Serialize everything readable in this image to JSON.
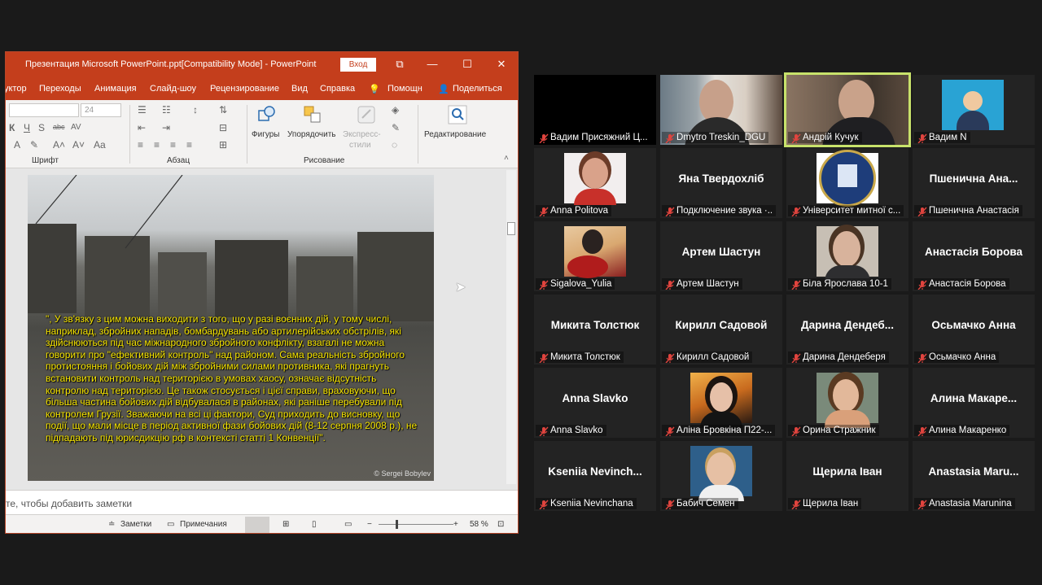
{
  "ppt": {
    "title": "Презентация Microsoft PowerPoint.ppt[Compatibility Mode]  -  PowerPoint",
    "signin_label": "Вход",
    "menu": [
      "уктор",
      "Переходы",
      "Анимация",
      "Слайд-шоу",
      "Рецензирование",
      "Вид",
      "Справка",
      "Помощн",
      "Поделиться"
    ],
    "ribbon": {
      "font_size": "24",
      "group_font": "Шрифт",
      "group_paragraph": "Абзац",
      "group_drawing": "Рисование",
      "shapes_label": "Фигуры",
      "arrange_label": "Упорядочить",
      "quick_styles_label_1": "Экспресс-",
      "quick_styles_label_2": "стили",
      "editing_label": "Редактирование"
    },
    "slide_text": "\", У зв'язку з цим можна виходити з того, що у разі воєнних дій, у тому числі, наприклад, збройних нападів, бомбардувань або артилерійських обстрілів, які здійснюються під час міжнародного збройного конфлікту, взагалі не можна говорити про \"ефективний контроль\" над районом. Сама реальність збройного протистояння і бойових дій між збройними силами противника, які прагнуть встановити контроль над територією в умовах хаосу, означає відсутність контролю над територією. Це також стосується і цієї справи, враховуючи, що більша частина бойових дій відбувалася в районах, які раніше перебували під контролем Грузії. Зважаючи на всі ці фактори, Суд приходить до висновку, що події, що мали місце в період активної фази бойових дій (8-12 серпня 2008 р.), не підпадають під юрисдикцію рф в контексті статті 1 Конвенції\".",
    "slide_credit": "© Sergei Bobylev",
    "notes_placeholder": "те, чтобы добавить заметки",
    "status": {
      "notes_label": "Заметки",
      "comments_label": "Примечания",
      "zoom": "58 %"
    }
  },
  "participants": [
    {
      "name": "Вадим Присяжний Ц...",
      "display": "",
      "kind": "black"
    },
    {
      "name": "Dmytro Treskin_DGU",
      "display": "",
      "kind": "video1"
    },
    {
      "name": "Андрій Кучук",
      "display": "",
      "kind": "video2",
      "active": true
    },
    {
      "name": "Вадим N",
      "display": "",
      "kind": "avatar-icon"
    },
    {
      "name": "Anna Politova",
      "display": "",
      "kind": "photo-woman"
    },
    {
      "name": "Подключение звука ·..",
      "display": "Яна Твердохліб",
      "kind": "text"
    },
    {
      "name": "Університет митної с...",
      "display": "",
      "kind": "logo"
    },
    {
      "name": "Пшенична Анастасія",
      "display": "Пшенична  Ана...",
      "kind": "text"
    },
    {
      "name": "Sigalova_Yulia",
      "display": "",
      "kind": "photo-roses"
    },
    {
      "name": "Артем Шастун",
      "display": "Артем Шастун",
      "kind": "text"
    },
    {
      "name": "Біла Ярослава 10-1",
      "display": "",
      "kind": "photo-girl1"
    },
    {
      "name": "Анастасія Борова",
      "display": "Анастасія Борова",
      "kind": "text"
    },
    {
      "name": "Микита Толстюк",
      "display": "Микита Толстюк",
      "kind": "text"
    },
    {
      "name": "Кирилл Садовой",
      "display": "Кирилл Садовой",
      "kind": "text"
    },
    {
      "name": "Дарина Дендеберя",
      "display": "Дарина  Дендеб...",
      "kind": "text"
    },
    {
      "name": "Осьмачко Анна",
      "display": "Осьмачко Анна",
      "kind": "text"
    },
    {
      "name": "Anna Slavko",
      "display": "Anna Slavko",
      "kind": "text"
    },
    {
      "name": "Аліна Бровкіна П22-...",
      "display": "",
      "kind": "photo-girl2"
    },
    {
      "name": "Орина Стражник",
      "display": "",
      "kind": "photo-girl3"
    },
    {
      "name": "Алина Макаренко",
      "display": "Алина  Макаре...",
      "kind": "text"
    },
    {
      "name": "Kseniia Nevinchana",
      "display": "Kseniia  Nevinch...",
      "kind": "text"
    },
    {
      "name": "Бабич Семен",
      "display": "",
      "kind": "photo-boy"
    },
    {
      "name": "Щерила Іван",
      "display": "Щерила Іван",
      "kind": "text"
    },
    {
      "name": "Anastasia Marunina",
      "display": "Anastasia  Maru...",
      "kind": "text"
    }
  ],
  "colors": {
    "ppt_accent": "#c43e1c",
    "active_speaker": "#c8e26b",
    "muted_icon": "#e0443e",
    "slide_text": "#f7e500"
  }
}
